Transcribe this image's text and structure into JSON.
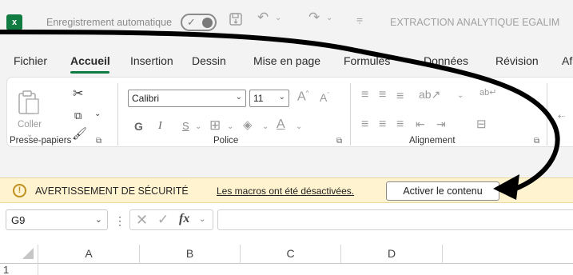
{
  "titlebar": {
    "logo_letter": "x",
    "autosave_label": "Enregistrement automatique",
    "doc_title": "EXTRACTION ANALYTIQUE EGALIM"
  },
  "menu": {
    "tabs": [
      "Fichier",
      "Accueil",
      "Insertion",
      "Dessin",
      "Mise en page",
      "Formules",
      "Données",
      "Révision",
      "Af"
    ],
    "active_tab": "Accueil"
  },
  "ribbon": {
    "clipboard": {
      "paste_label": "Coller",
      "group_label": "Presse-papiers"
    },
    "font": {
      "font_name": "Calibri",
      "font_size": "11",
      "bold": "G",
      "italic": "I",
      "underline": "S",
      "group_label": "Police"
    },
    "alignment": {
      "group_label": "Alignement"
    }
  },
  "security_bar": {
    "title": "AVERTISSEMENT DE SÉCURITÉ",
    "message_link": "Les macros ont été désactivées.",
    "enable_button": "Activer le contenu"
  },
  "formula_bar": {
    "name_box": "G9",
    "formula": ""
  },
  "grid": {
    "columns": [
      "A",
      "B",
      "C",
      "D"
    ],
    "rows": [
      "1"
    ]
  },
  "colors": {
    "excel_green": "#107c41",
    "security_bar_bg": "#fff4cf",
    "annotation_arrow": "#000000"
  }
}
